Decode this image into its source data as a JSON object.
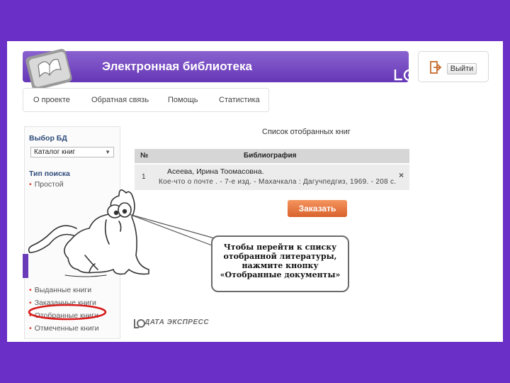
{
  "header": {
    "title": "Электронная библиотека",
    "exit_label": "Выйти"
  },
  "nav": {
    "items": [
      "О проекте",
      "Обратная связь",
      "Помощь",
      "Статистика"
    ]
  },
  "sidebar": {
    "db_heading": "Выбор БД",
    "db_selected": "Каталог книг",
    "search_type_heading": "Тип поиска",
    "search_types": [
      "Простой"
    ],
    "links": [
      "Выданные книги",
      "Заказанные книги",
      "Отобранные книги",
      "Отмеченные книги"
    ]
  },
  "main": {
    "list_title": "Список отобранных книг",
    "columns": [
      "№",
      "Библиография"
    ],
    "rows": [
      {
        "num": "1",
        "author": "Асеева, Ирина Тоомасовна.",
        "description": "Кое-что о почте . - 7-е изд. - Махачкала : Дагучпедгиз, 1969. - 208 с."
      }
    ],
    "order_label": "Заказать"
  },
  "footer": {
    "brand": "ДАТА ЭКСПРЕСС"
  },
  "callout": {
    "lines": [
      "Чтобы перейти к списку",
      "отобранной литературы,",
      "нажмите кнопку",
      "«Отобранные документы»"
    ]
  },
  "colors": {
    "frame": "#6a2fc6",
    "header": "#7a4fc4",
    "order_button": "#e8743c",
    "highlight": "#d81b1b"
  }
}
